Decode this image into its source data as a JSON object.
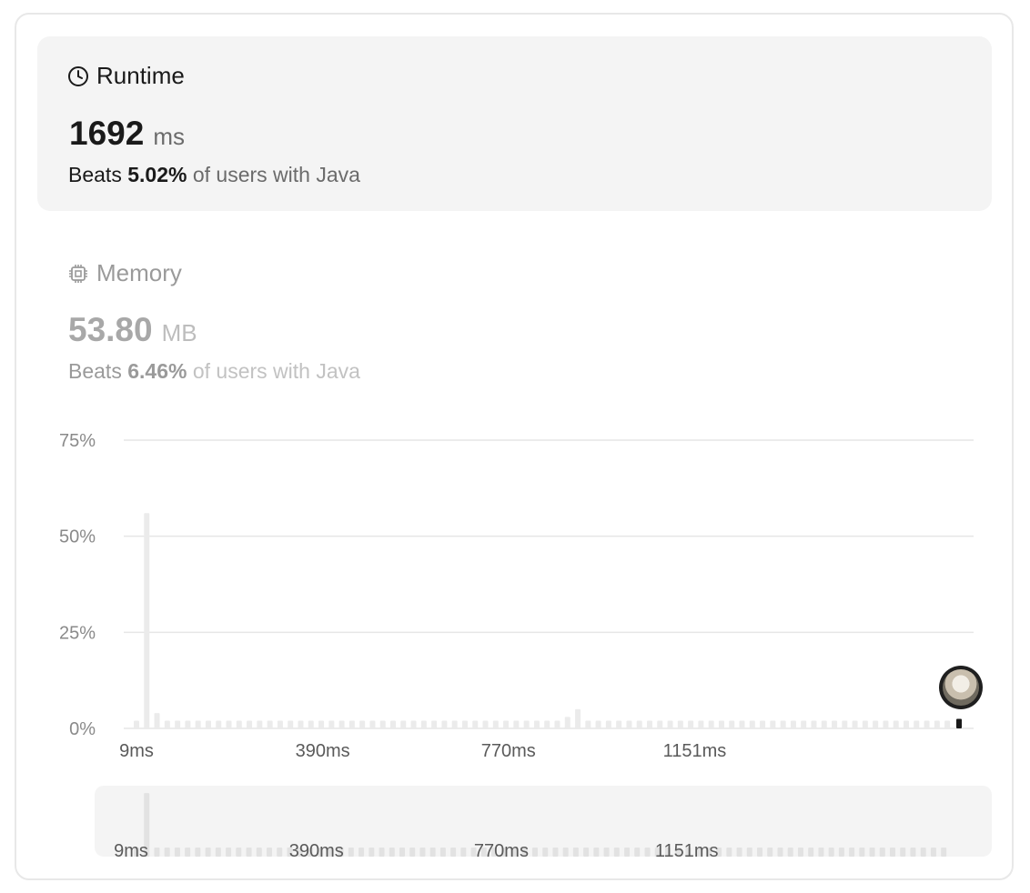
{
  "runtime": {
    "title": "Runtime",
    "value": "1692",
    "unit": "ms",
    "beats_prefix": "Beats",
    "beats_pct": "5.02%",
    "beats_suffix": "of users with Java"
  },
  "memory": {
    "title": "Memory",
    "value": "53.80",
    "unit": "MB",
    "beats_prefix": "Beats",
    "beats_pct": "6.46%",
    "beats_suffix": "of users with Java"
  },
  "icons": {
    "runtime": "clock-icon",
    "memory": "chip-icon",
    "avatar": "user-avatar"
  },
  "colors": {
    "accent_bar": "#1a1a1a",
    "bar": "#ebebeb",
    "panel": "#f4f4f4"
  },
  "chart_data": {
    "type": "bar",
    "title": "",
    "xlabel": "",
    "ylabel": "",
    "y_ticks": [
      "0%",
      "25%",
      "50%",
      "75%"
    ],
    "ylim": [
      0,
      75
    ],
    "x_ticks": [
      "9ms",
      "390ms",
      "770ms",
      "1151ms"
    ],
    "xlim": [
      9,
      1692
    ],
    "series": [
      {
        "values": [
          {
            "x": 9,
            "y": 2
          },
          {
            "x": 30,
            "y": 56
          },
          {
            "x": 51,
            "y": 4
          },
          {
            "x": 72,
            "y": 2
          },
          {
            "x": 93,
            "y": 2
          },
          {
            "x": 114,
            "y": 2
          },
          {
            "x": 135,
            "y": 2
          },
          {
            "x": 156,
            "y": 2
          },
          {
            "x": 177,
            "y": 2
          },
          {
            "x": 198,
            "y": 2
          },
          {
            "x": 219,
            "y": 2
          },
          {
            "x": 240,
            "y": 2
          },
          {
            "x": 261,
            "y": 2
          },
          {
            "x": 282,
            "y": 2
          },
          {
            "x": 303,
            "y": 2
          },
          {
            "x": 324,
            "y": 2
          },
          {
            "x": 345,
            "y": 2
          },
          {
            "x": 366,
            "y": 2
          },
          {
            "x": 387,
            "y": 2
          },
          {
            "x": 408,
            "y": 2
          },
          {
            "x": 429,
            "y": 2
          },
          {
            "x": 450,
            "y": 2
          },
          {
            "x": 471,
            "y": 2
          },
          {
            "x": 492,
            "y": 2
          },
          {
            "x": 513,
            "y": 2
          },
          {
            "x": 534,
            "y": 2
          },
          {
            "x": 555,
            "y": 2
          },
          {
            "x": 576,
            "y": 2
          },
          {
            "x": 597,
            "y": 2
          },
          {
            "x": 618,
            "y": 2
          },
          {
            "x": 639,
            "y": 2
          },
          {
            "x": 660,
            "y": 2
          },
          {
            "x": 681,
            "y": 2
          },
          {
            "x": 702,
            "y": 2
          },
          {
            "x": 723,
            "y": 2
          },
          {
            "x": 744,
            "y": 2
          },
          {
            "x": 765,
            "y": 2
          },
          {
            "x": 786,
            "y": 2
          },
          {
            "x": 807,
            "y": 2
          },
          {
            "x": 828,
            "y": 2
          },
          {
            "x": 849,
            "y": 2
          },
          {
            "x": 870,
            "y": 2
          },
          {
            "x": 891,
            "y": 3
          },
          {
            "x": 912,
            "y": 5
          },
          {
            "x": 933,
            "y": 2
          },
          {
            "x": 954,
            "y": 2
          },
          {
            "x": 975,
            "y": 2
          },
          {
            "x": 996,
            "y": 2
          },
          {
            "x": 1017,
            "y": 2
          },
          {
            "x": 1038,
            "y": 2
          },
          {
            "x": 1059,
            "y": 2
          },
          {
            "x": 1080,
            "y": 2
          },
          {
            "x": 1101,
            "y": 2
          },
          {
            "x": 1122,
            "y": 2
          },
          {
            "x": 1143,
            "y": 2
          },
          {
            "x": 1164,
            "y": 2
          },
          {
            "x": 1185,
            "y": 2
          },
          {
            "x": 1206,
            "y": 2
          },
          {
            "x": 1227,
            "y": 2
          },
          {
            "x": 1248,
            "y": 2
          },
          {
            "x": 1269,
            "y": 2
          },
          {
            "x": 1290,
            "y": 2
          },
          {
            "x": 1311,
            "y": 2
          },
          {
            "x": 1332,
            "y": 2
          },
          {
            "x": 1353,
            "y": 2
          },
          {
            "x": 1374,
            "y": 2
          },
          {
            "x": 1395,
            "y": 2
          },
          {
            "x": 1416,
            "y": 2
          },
          {
            "x": 1437,
            "y": 2
          },
          {
            "x": 1458,
            "y": 2
          },
          {
            "x": 1479,
            "y": 2
          },
          {
            "x": 1500,
            "y": 2
          },
          {
            "x": 1521,
            "y": 2
          },
          {
            "x": 1542,
            "y": 2
          },
          {
            "x": 1563,
            "y": 2
          },
          {
            "x": 1584,
            "y": 2
          },
          {
            "x": 1605,
            "y": 2
          },
          {
            "x": 1626,
            "y": 2
          },
          {
            "x": 1647,
            "y": 2
          },
          {
            "x": 1668,
            "y": 2
          }
        ]
      }
    ],
    "highlight": {
      "x": 1692,
      "y": 2
    },
    "grid": true,
    "navigator": {
      "x_ticks": [
        "9ms",
        "390ms",
        "770ms",
        "1151ms"
      ]
    }
  }
}
